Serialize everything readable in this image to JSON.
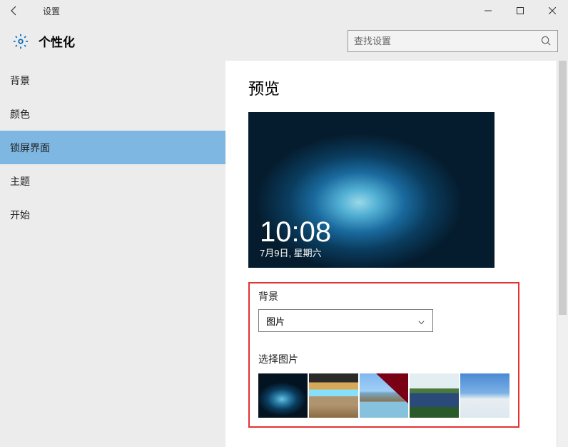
{
  "window": {
    "title": "设置"
  },
  "header": {
    "page_title": "个性化",
    "search_placeholder": "查找设置"
  },
  "sidebar": {
    "items": [
      {
        "label": "背景"
      },
      {
        "label": "颜色"
      },
      {
        "label": "锁屏界面"
      },
      {
        "label": "主题"
      },
      {
        "label": "开始"
      }
    ],
    "active_index": 2
  },
  "content": {
    "preview_heading": "预览",
    "preview_time": "10:08",
    "preview_date": "7月9日, 星期六",
    "background_label": "背景",
    "background_dropdown_value": "图片",
    "choose_picture_label": "选择图片"
  }
}
